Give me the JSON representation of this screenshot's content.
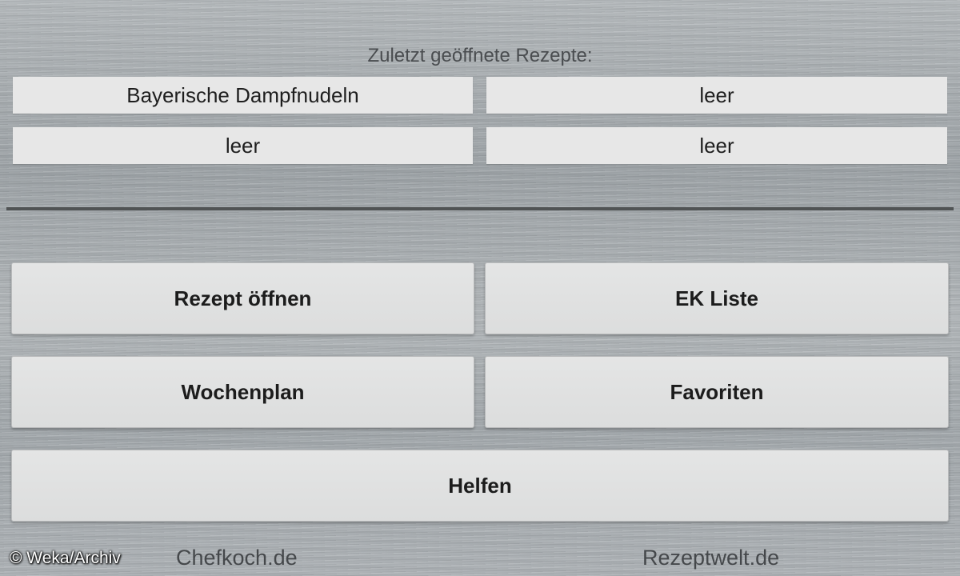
{
  "recent": {
    "title": "Zuletzt geöffnete Rezepte:",
    "items": [
      {
        "label": "Bayerische Dampfnudeln"
      },
      {
        "label": "leer"
      },
      {
        "label": "leer"
      },
      {
        "label": "leer"
      }
    ]
  },
  "main": {
    "rezept_oeffnen": "Rezept öffnen",
    "ek_liste": "EK Liste",
    "wochenplan": "Wochenplan",
    "favoriten": "Favoriten",
    "helfen": "Helfen"
  },
  "footer": {
    "copyright": "© Weka/Archiv",
    "link_chefkoch": "Chefkoch.de",
    "link_rezeptwelt": "Rezeptwelt.de"
  },
  "colors": {
    "button_bg": "#e7e7e7",
    "divider": "#505354",
    "text_dark": "#1e1e1e"
  }
}
